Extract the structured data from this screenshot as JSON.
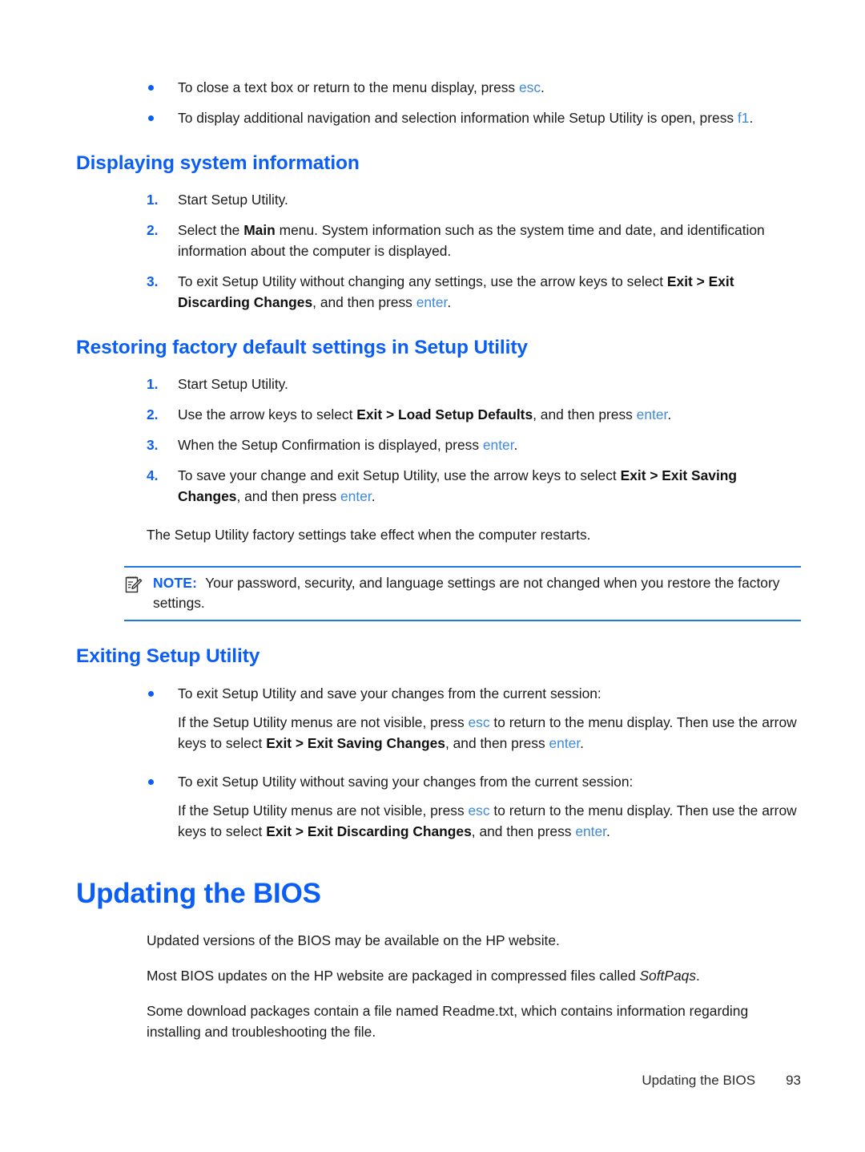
{
  "document": {
    "intro_bullets": [
      {
        "pre": "To close a text box or return to the menu display, press ",
        "key": "esc",
        "post": "."
      },
      {
        "pre": "To display additional navigation and selection information while Setup Utility is open, press ",
        "key": "f1",
        "post": "."
      }
    ],
    "sections": [
      {
        "heading": "Displaying system information",
        "steps": [
          {
            "num": "1.",
            "text": "Start Setup Utility."
          },
          {
            "num": "2.",
            "pre": "Select the ",
            "bold": "Main",
            "post": " menu. System information such as the system time and date, and identification information about the computer is displayed."
          },
          {
            "num": "3.",
            "pre": "To exit Setup Utility without changing any settings, use the arrow keys to select ",
            "bold": "Exit > Exit Discarding Changes",
            "mid": ", and then press ",
            "key": "enter",
            "post": "."
          }
        ]
      },
      {
        "heading": "Restoring factory default settings in Setup Utility",
        "steps": [
          {
            "num": "1.",
            "text": "Start Setup Utility."
          },
          {
            "num": "2.",
            "pre": "Use the arrow keys to select ",
            "bold": "Exit > Load Setup Defaults",
            "mid": ", and then press ",
            "key": "enter",
            "post": "."
          },
          {
            "num": "3.",
            "pre": "When the Setup Confirmation is displayed, press ",
            "key": "enter",
            "post": "."
          },
          {
            "num": "4.",
            "pre": "To save your change and exit Setup Utility, use the arrow keys to select ",
            "bold": "Exit > Exit Saving Changes",
            "mid": ", and then press ",
            "key": "enter",
            "post": "."
          }
        ],
        "closing_paragraph": "The Setup Utility factory settings take effect when the computer restarts."
      },
      {
        "heading": "Exiting Setup Utility",
        "bullets": [
          {
            "lead": "To exit Setup Utility and save your changes from the current session:",
            "pre": "If the Setup Utility menus are not visible, press ",
            "key1": "esc",
            "mid1": " to return to the menu display. Then use the arrow keys to select ",
            "bold": "Exit > Exit Saving Changes",
            "mid2": ", and then press ",
            "key2": "enter",
            "post": "."
          },
          {
            "lead": "To exit Setup Utility without saving your changes from the current session:",
            "pre": "If the Setup Utility menus are not visible, press ",
            "key1": "esc",
            "mid1": " to return to the menu display. Then use the arrow keys to select ",
            "bold": "Exit > Exit Discarding Changes",
            "mid2": ", and then press ",
            "key2": "enter",
            "post": "."
          }
        ]
      }
    ],
    "note": {
      "label": "NOTE:",
      "text": "Your password, security, and language settings are not changed when you restore the factory settings.",
      "icon": "note-pencil-icon"
    },
    "chapter": {
      "heading": "Updating the BIOS",
      "paragraphs": [
        {
          "text": "Updated versions of the BIOS may be available on the HP website."
        },
        {
          "pre": "Most BIOS updates on the HP website are packaged in compressed files called ",
          "italic": "SoftPaqs",
          "post": "."
        },
        {
          "text": "Some download packages contain a file named Readme.txt, which contains information regarding installing and troubleshooting the file."
        }
      ]
    },
    "footer": {
      "title": "Updating the BIOS",
      "page_number": "93"
    },
    "colors": {
      "heading_blue": "#0b5ef5",
      "key_blue": "#3d8ade",
      "rule_blue": "#1f7ae0",
      "body_text": "#1a1a1a"
    }
  }
}
